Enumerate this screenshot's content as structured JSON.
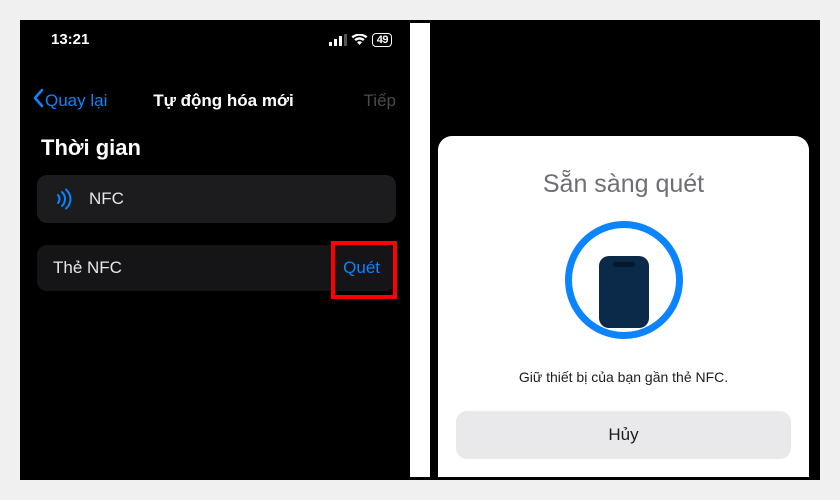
{
  "statusBar": {
    "time": "13:21",
    "battery": "49"
  },
  "nav": {
    "back": "Quay lại",
    "title": "Tự động hóa mới",
    "next": "Tiếp"
  },
  "section": {
    "title": "Thời gian"
  },
  "nfcCell": {
    "label": "NFC"
  },
  "tagCell": {
    "label": "Thẻ NFC",
    "action": "Quét"
  },
  "sheet": {
    "title": "Sẵn sàng quét",
    "message": "Giữ thiết bị của bạn gần thẻ NFC.",
    "cancel": "Hủy"
  }
}
